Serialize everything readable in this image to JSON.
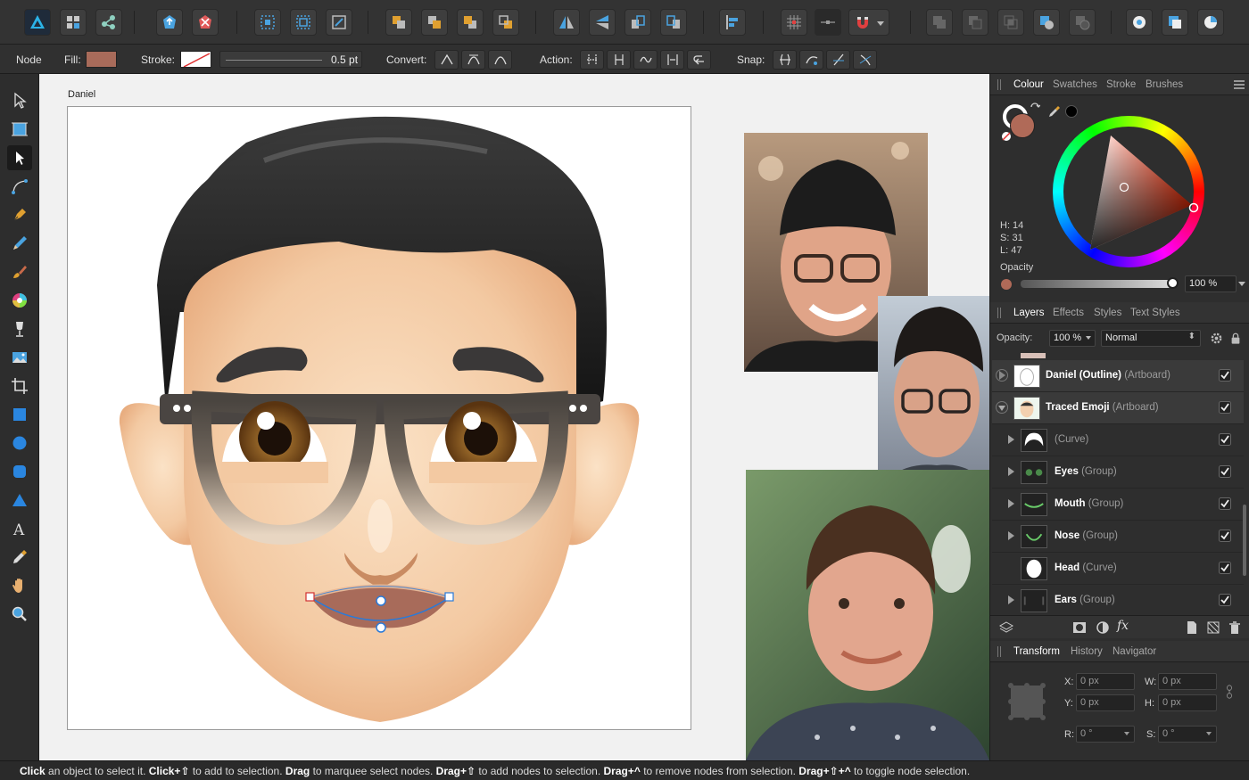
{
  "context_bar": {
    "mode": "Node",
    "fill_label": "Fill:",
    "fill_color": "#a86b5a",
    "stroke_label": "Stroke:",
    "stroke_width": "0.5 pt",
    "convert_label": "Convert:",
    "action_label": "Action:",
    "snap_label": "Snap:"
  },
  "canvas": {
    "artboard_name": "Daniel"
  },
  "colour_panel": {
    "tabs": [
      "Colour",
      "Swatches",
      "Stroke",
      "Brushes"
    ],
    "current_color": "#b06a58",
    "h": "H: 14",
    "s": "S: 31",
    "l": "L: 47",
    "opacity_label": "Opacity",
    "opacity_value": "100 %"
  },
  "layers_panel": {
    "tabs": [
      "Layers",
      "Effects",
      "Styles",
      "Text Styles"
    ],
    "opacity_label": "Opacity:",
    "opacity_value": "100 %",
    "blend_mode": "Normal",
    "layers": [
      {
        "name": "Daniel (Outline)",
        "type": "(Artboard)",
        "level": 0,
        "expanded": false
      },
      {
        "name": "Traced Emoji",
        "type": "(Artboard)",
        "level": 0,
        "expanded": true
      },
      {
        "name": "",
        "type": "(Curve)",
        "level": 1,
        "expanded": false
      },
      {
        "name": "Eyes",
        "type": "(Group)",
        "level": 1,
        "expanded": false
      },
      {
        "name": "Mouth",
        "type": "(Group)",
        "level": 1,
        "expanded": false
      },
      {
        "name": "Nose",
        "type": "(Group)",
        "level": 1,
        "expanded": false
      },
      {
        "name": "Head",
        "type": "(Curve)",
        "level": 1,
        "expanded": false
      },
      {
        "name": "Ears",
        "type": "(Group)",
        "level": 1,
        "expanded": false
      }
    ]
  },
  "transform_panel": {
    "tabs": [
      "Transform",
      "History",
      "Navigator"
    ],
    "x_label": "X:",
    "x_value": "0 px",
    "y_label": "Y:",
    "y_value": "0 px",
    "w_label": "W:",
    "w_value": "0 px",
    "h_label": "H:",
    "h_value": "0 px",
    "r_label": "R:",
    "r_value": "0 °",
    "s_label": "S:",
    "s_value": "0 °"
  },
  "status": {
    "click": "Click",
    "t1": " an object to select it. ",
    "click_shift": "Click+⇧",
    "t2": " to add to selection. ",
    "drag": "Drag",
    "t3": " to marquee select nodes. ",
    "drag_shift": "Drag+⇧",
    "t4": " to add nodes to selection. ",
    "drag_ctrl": "Drag+^",
    "t5": " to remove nodes from selection. ",
    "drag_shift_ctrl": "Drag+⇧+^",
    "t6": " to toggle node selection."
  }
}
